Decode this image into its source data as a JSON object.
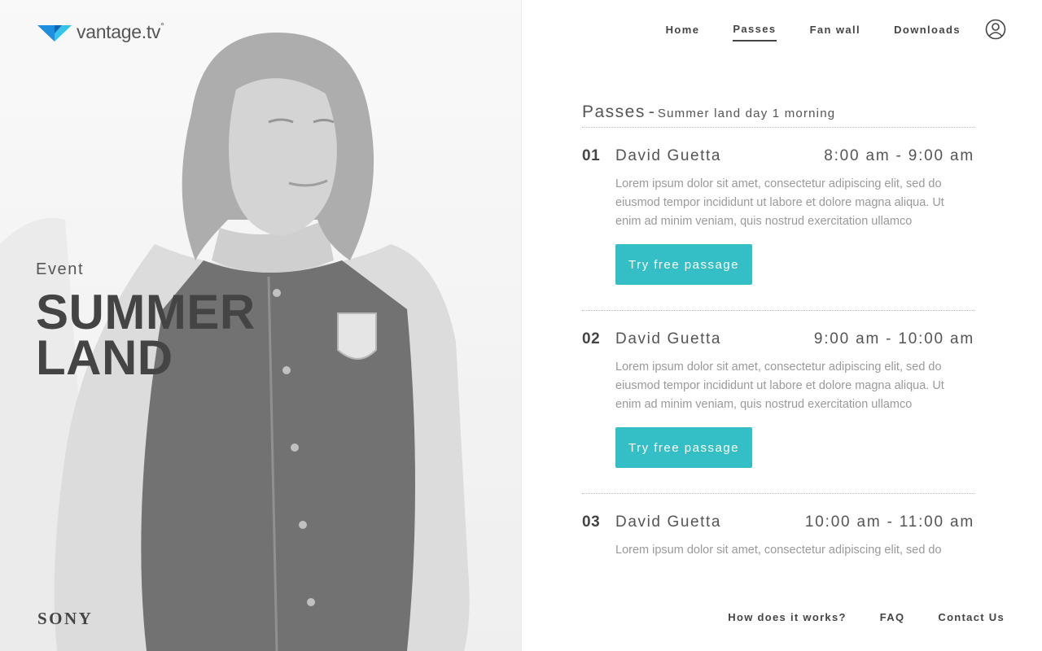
{
  "brand": {
    "name": "vantage.tv",
    "degree": "°",
    "logo_colors": [
      "#1e8fe0",
      "#37c3e8"
    ]
  },
  "event": {
    "label": "Event",
    "title_line1": "SUMMER",
    "title_line2": "LAND"
  },
  "sponsor": {
    "name": "SONY"
  },
  "nav": {
    "items": [
      {
        "label": "Home",
        "active": false
      },
      {
        "label": "Passes",
        "active": true
      },
      {
        "label": "Fan wall",
        "active": false
      },
      {
        "label": "Downloads",
        "active": false
      }
    ],
    "account_icon": "user-circle-icon"
  },
  "passes": {
    "title": "Passes",
    "separator": "-",
    "subtitle": "Summer land day 1 morning",
    "items": [
      {
        "number": "01",
        "artist": "David Guetta",
        "time": "8:00 am - 9:00 am",
        "description": "Lorem ipsum dolor sit amet, consectetur adipiscing elit, sed do eiusmod tempor incididunt ut labore et dolore magna aliqua. Ut enim ad minim veniam, quis nostrud exercitation ullamco",
        "button": "Try free passage"
      },
      {
        "number": "02",
        "artist": "David Guetta",
        "time": "9:00 am - 10:00 am",
        "description": "Lorem ipsum dolor sit amet, consectetur adipiscing elit, sed do eiusmod tempor incididunt ut labore et dolore magna aliqua. Ut enim ad minim veniam, quis nostrud exercitation ullamco",
        "button": "Try free passage"
      },
      {
        "number": "03",
        "artist": "David Guetta",
        "time": "10:00 am - 11:00 am",
        "description": "Lorem ipsum dolor sit amet, consectetur adipiscing elit, sed do"
      }
    ]
  },
  "footer": {
    "items": [
      {
        "label": "How does it works?"
      },
      {
        "label": "FAQ"
      },
      {
        "label": "Contact Us"
      }
    ]
  },
  "colors": {
    "accent": "#34bec6",
    "text": "#444444",
    "muted": "#9a9a9a"
  }
}
